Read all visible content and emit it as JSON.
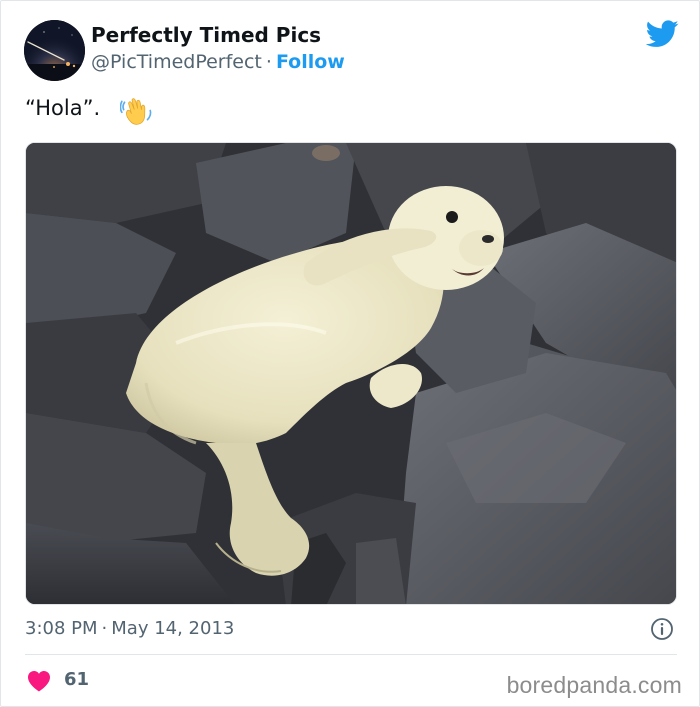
{
  "author": {
    "display_name": "Perfectly Timed Pics",
    "handle": "@PicTimedPerfect",
    "separator": "·",
    "follow_label": "Follow",
    "avatar_icon": "night-sky-avatar"
  },
  "brand": {
    "icon": "twitter-bird-icon",
    "color": "#1d9bf0"
  },
  "tweet": {
    "text": "“Hola”.",
    "emoji_icon": "waving-hand-icon"
  },
  "media": {
    "type": "photo",
    "subject": "seal-pup-waving-on-rocks"
  },
  "meta": {
    "time": "3:08 PM",
    "separator": "·",
    "date": "May 14, 2013",
    "info_icon": "info-icon"
  },
  "engagement": {
    "like_icon": "heart-icon",
    "like_color": "#f91880",
    "like_count": "61"
  },
  "watermark": {
    "text": "boredpanda.com"
  }
}
